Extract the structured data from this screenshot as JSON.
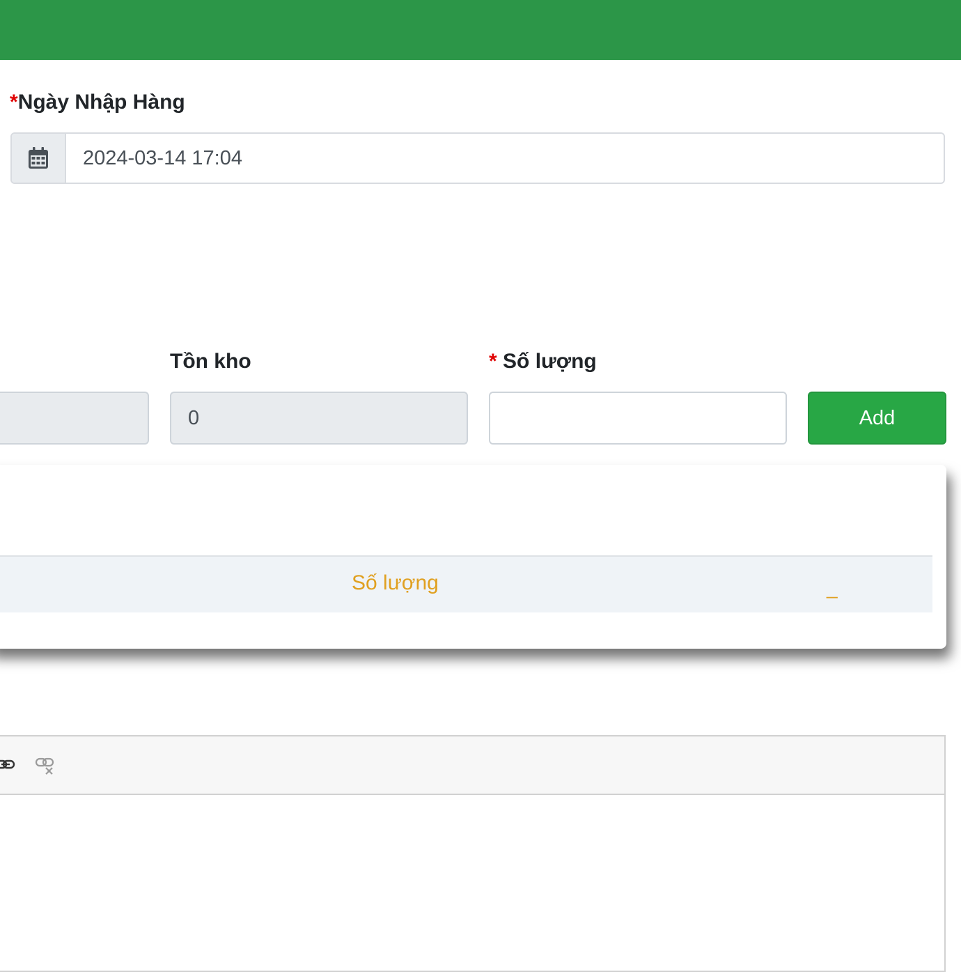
{
  "header": {
    "color": "#2c9648"
  },
  "import_date": {
    "required_mark": "*",
    "label": "Ngày Nhập Hàng",
    "value": "2024-03-14 17:04",
    "icon": "calendar-icon"
  },
  "product_row": {
    "unlabeled_field_value": "",
    "stock": {
      "label": "Tồn kho",
      "value": "0"
    },
    "quantity": {
      "required_mark": "*",
      "label": "Số lượng",
      "value": ""
    },
    "add_button": {
      "label": "Add",
      "color": "#28a745"
    }
  },
  "items_table": {
    "columns": [
      {
        "label": "Số lượng"
      },
      {
        "label": "_"
      }
    ],
    "header_color": "#e0a020"
  },
  "editor": {
    "toolbar_icons": [
      "link-icon",
      "unlink-icon"
    ]
  }
}
